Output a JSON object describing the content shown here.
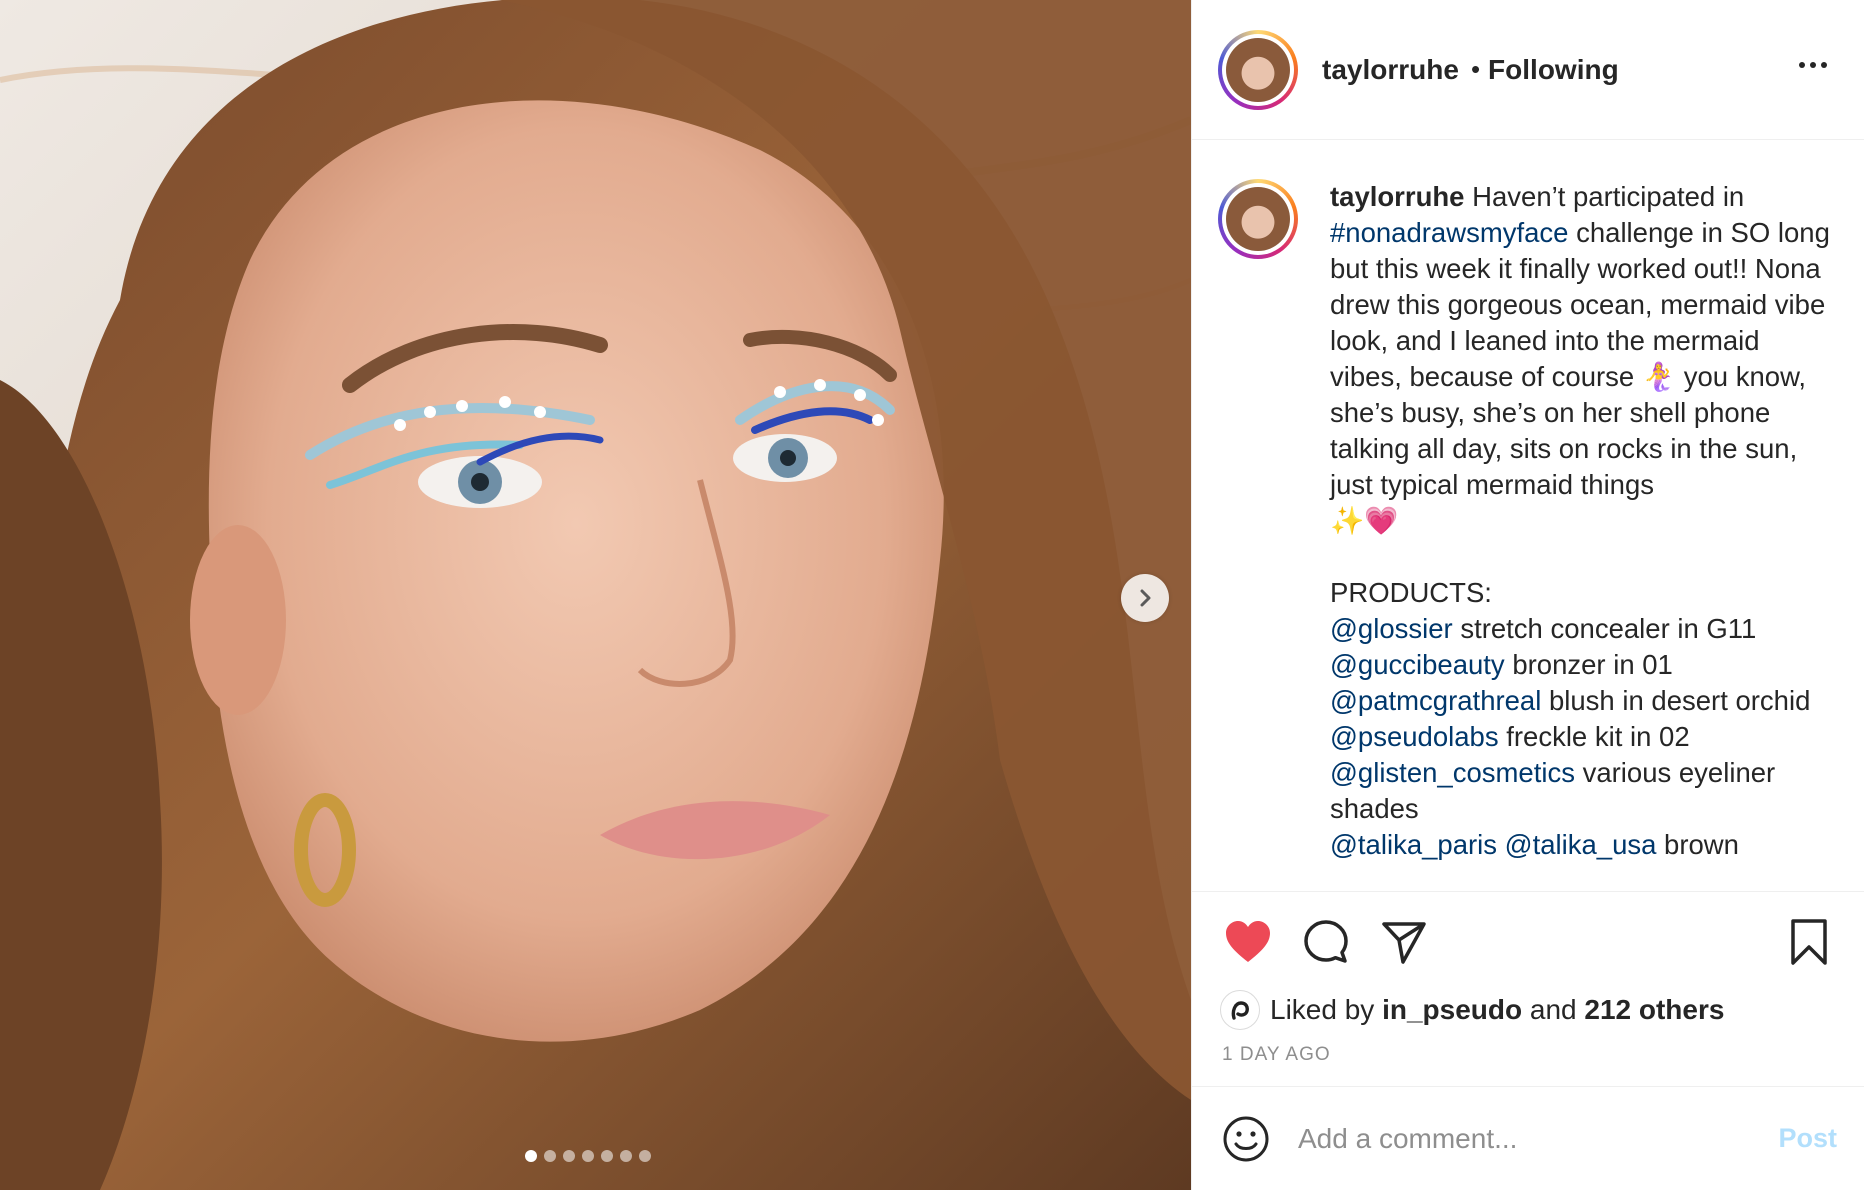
{
  "header": {
    "username": "taylorruhe",
    "separator": "•",
    "follow_status": "Following"
  },
  "caption": {
    "username": "taylorruhe",
    "parts": {
      "p1": "Haven’t participated in",
      "hashtag": "#nonadrawsmyface",
      "p2": "challenge in SO long but this week it finally worked out!! Nona drew this gorgeous ocean, mermaid vibe look, and I leaned into the mermaid vibes, because of course",
      "emoji_mermaid": "🧜‍♀️",
      "p3": "you know, she’s busy, she’s on her shell phone talking all day, sits on rocks in the sun, just typical mermaid things",
      "emoji_end": "✨💗"
    },
    "products_heading": "PRODUCTS:",
    "products": [
      {
        "handle": "@glossier",
        "text": "stretch concealer in G11"
      },
      {
        "handle": "@guccibeauty",
        "text": "bronzer in 01"
      },
      {
        "handle": "@patmcgrathreal",
        "text": "blush in desert orchid"
      },
      {
        "handle": "@pseudolabs",
        "text": "freckle kit in 02"
      },
      {
        "handle": "@glisten_cosmetics",
        "text": "various eyeliner shades"
      },
      {
        "handle": "@talika_paris",
        "handle2": "@talika_usa",
        "text": "brown"
      }
    ]
  },
  "actions": {
    "like_icon": "heart-filled-icon",
    "comment_icon": "comment-bubble-icon",
    "share_icon": "paper-plane-icon",
    "save_icon": "bookmark-icon",
    "like_color": "#ed4956"
  },
  "likes": {
    "prefix": "Liked by",
    "liker": "in_pseudo",
    "joiner": "and",
    "others": "212 others"
  },
  "timestamp": "1 DAY AGO",
  "comment_box": {
    "placeholder": "Add a comment...",
    "post_label": "Post",
    "emoji_icon": "smiley-icon"
  },
  "carousel": {
    "slide_count": 7,
    "active_index": 0,
    "next_icon": "chevron-right-icon"
  },
  "colors": {
    "link": "#00376b",
    "text": "#262626",
    "muted": "#8e8e8e",
    "post_disabled": "#b2dffc"
  }
}
